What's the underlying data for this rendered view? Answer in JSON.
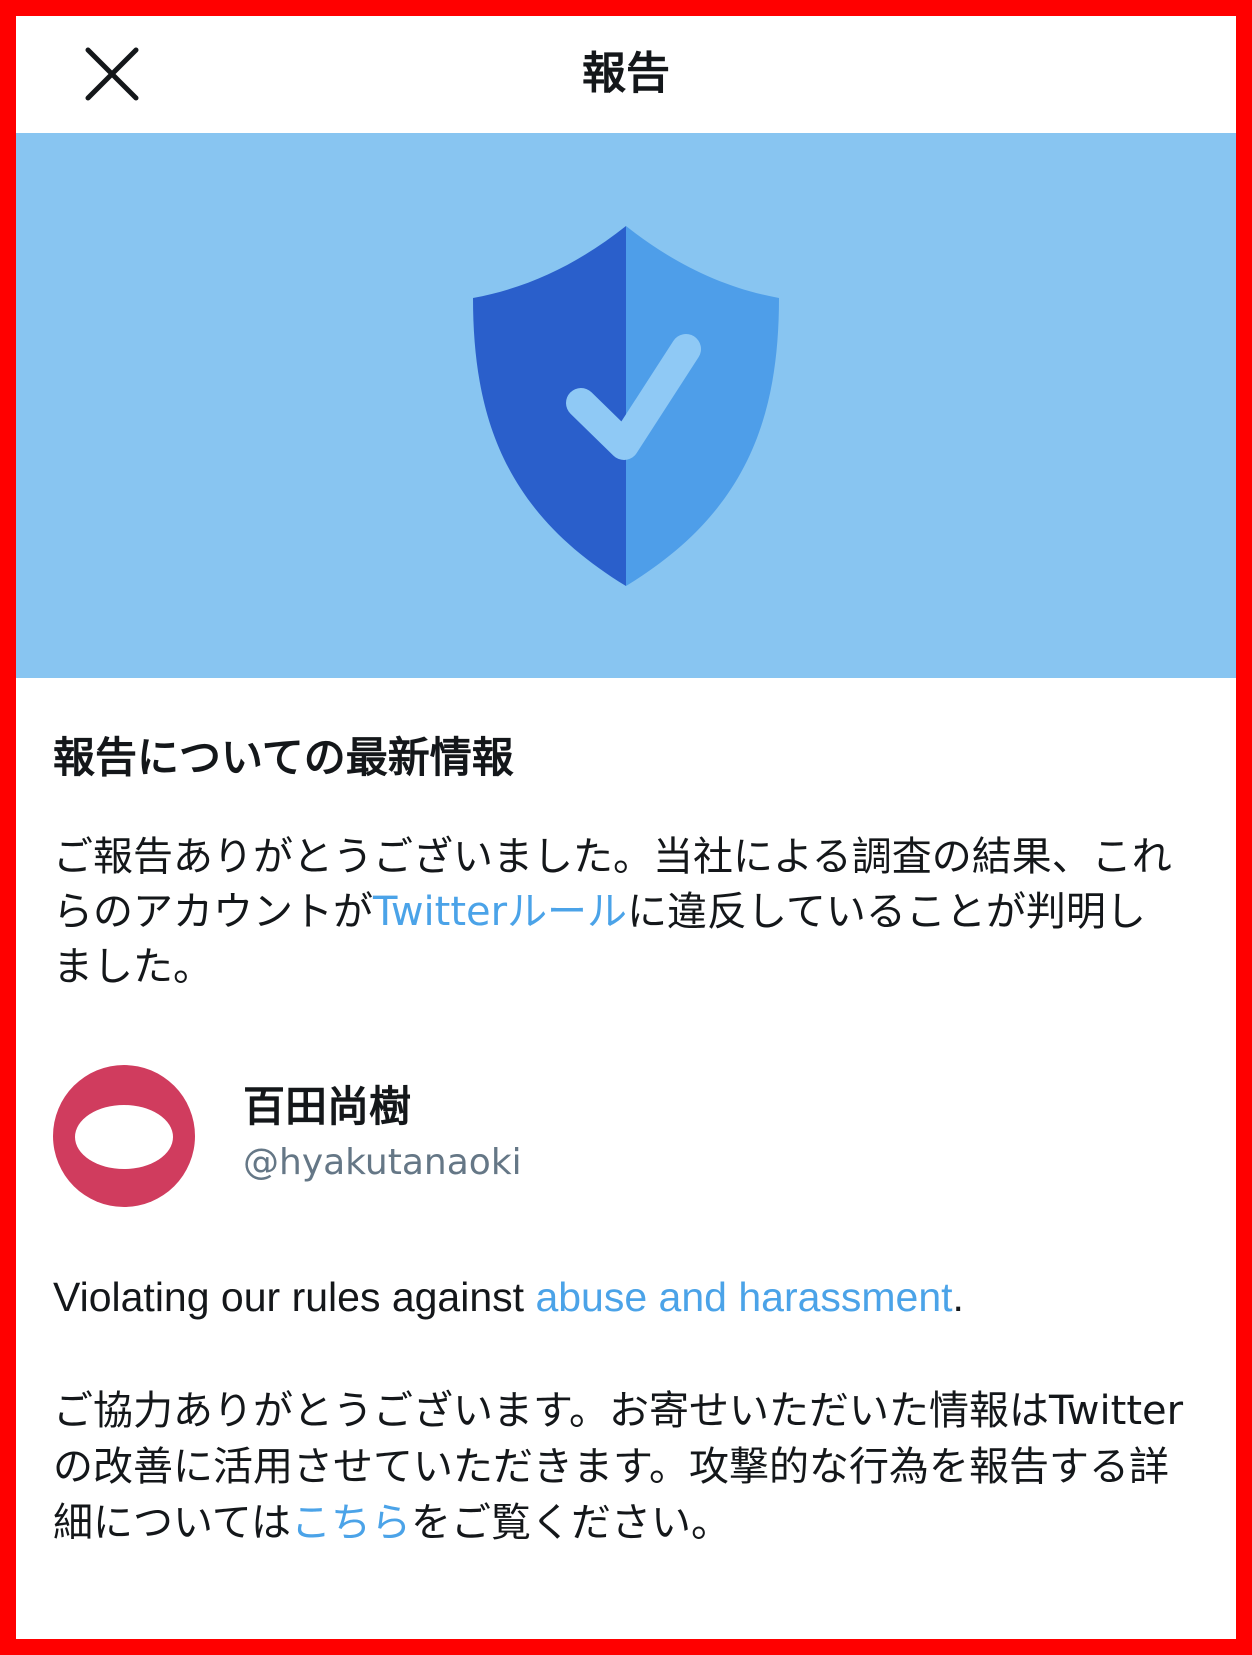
{
  "header": {
    "title": "報告"
  },
  "section": {
    "title": "報告についての最新情報"
  },
  "intro": {
    "before": "ご報告ありがとうございました。当社による調査の結果、これらのアカウントが",
    "link": "Twitterルール",
    "after": "に違反していることが判明しました。"
  },
  "account": {
    "name": "百田尚樹",
    "handle": "@hyakutanaoki"
  },
  "violation": {
    "before": "Violating our rules against ",
    "link": "abuse and harassment",
    "after": "."
  },
  "thanks": {
    "before": "ご協力ありがとうございます。お寄せいただいた情報はTwitterの改善に活用させていただきます。攻撃的な行為を報告する詳細については",
    "link": "こちら",
    "after": "をご覧ください。"
  },
  "colors": {
    "banner": "#88c5f1",
    "shield_dark": "#2a5fcb",
    "shield_light": "#4e9ee9",
    "link": "#4ba3e8",
    "avatar": "#d03c5e"
  },
  "icons": {
    "close": "close-icon",
    "shield": "shield-check-icon"
  }
}
